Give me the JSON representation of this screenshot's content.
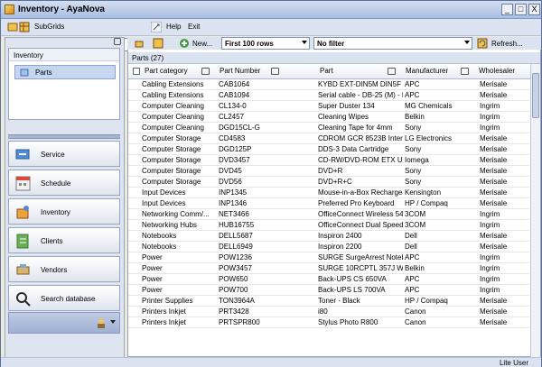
{
  "window": {
    "title": "Inventory - AyaNova",
    "controls": [
      "_",
      "□",
      "X"
    ]
  },
  "top_toolbar": {
    "subgrids_label": "SubGrids",
    "search_value": "",
    "help_label": "Help",
    "exit_label": "Exit"
  },
  "left_panel": {
    "header": "Inventory",
    "selected_item": "Parts",
    "nav_buttons": [
      {
        "label": "Service",
        "icon": "service-icon"
      },
      {
        "label": "Schedule",
        "icon": "schedule-icon"
      },
      {
        "label": "Inventory",
        "icon": "inventory-icon"
      },
      {
        "label": "Clients",
        "icon": "clients-icon"
      },
      {
        "label": "Vendors",
        "icon": "vendors-icon"
      },
      {
        "label": "Search database",
        "icon": "search-database-icon"
      }
    ]
  },
  "grid_toolbar": {
    "new_label": "New...",
    "rows_value": "First 100 rows",
    "filter_value": "No filter",
    "refresh_label": "Refresh..."
  },
  "grid": {
    "title": "Parts (27)",
    "columns": [
      "Part category",
      "Part Number",
      "Part",
      "Manufacturer",
      "Wholesaler"
    ],
    "rows": [
      [
        "Cabling Extensions",
        "CAB1064",
        "KYBD EXT-DIN5M DIN5F 6FT",
        "APC",
        "Merisale"
      ],
      [
        "Cabling Extensions",
        "CAB1094",
        "Serial cable - DB-25 (M) - DB-...",
        "APC",
        "Merisale"
      ],
      [
        "Computer Cleaning",
        "CL134-0",
        "Super Duster 134",
        "MG Chemicals",
        "Ingrim"
      ],
      [
        "Computer Cleaning",
        "CL2457",
        "Cleaning Wipes",
        "Belkin",
        "Ingrim"
      ],
      [
        "Computer Cleaning",
        "DGD15CL-G",
        "Cleaning Tape for 4mm",
        "Sony",
        "Ingrim"
      ],
      [
        "Computer Storage",
        "CD4583",
        "CDROM GCR 8523B Internal",
        "LG Electronics",
        "Merisale"
      ],
      [
        "Computer Storage",
        "DGD125P",
        "DDS-3 Data Cartridge",
        "Sony",
        "Merisale"
      ],
      [
        "Computer Storage",
        "DVD3457",
        "CD-RW/DVD-ROM ETX USB",
        "Iomega",
        "Merisale"
      ],
      [
        "Computer Storage",
        "DVD45",
        "DVD+R",
        "Sony",
        "Merisale"
      ],
      [
        "Computer Storage",
        "DVD56",
        "DVD+R+C",
        "Sony",
        "Merisale"
      ],
      [
        "Input Devices",
        "INP1345",
        "Mouse-in-a-Box Rechargeabl...",
        "Kensington",
        "Merisale"
      ],
      [
        "Input Devices",
        "INP1346",
        "Preferred Pro Keyboard",
        "HP / Compaq",
        "Merisale"
      ],
      [
        "Networking Comm/...",
        "NET3466",
        "OfficeConnect Wireless 54Mb...",
        "3COM",
        "Ingrim"
      ],
      [
        "Networking Hubs",
        "HUB16755",
        "OfficeConnect Dual Speed Hu...",
        "3COM",
        "Ingrim"
      ],
      [
        "Notebooks",
        "DELL5687",
        "Inspiron 2400",
        "Dell",
        "Merisale"
      ],
      [
        "Notebooks",
        "DELL6949",
        "Inspiron 2200",
        "Dell",
        "Merisale"
      ],
      [
        "Power",
        "POW1236",
        "SURGE SurgeArrest Noteboo...",
        "APC",
        "Ingrim"
      ],
      [
        "Power",
        "POW3457",
        "SURGE 10RCPTL 357J WM 5...",
        "Belkin",
        "Ingrim"
      ],
      [
        "Power",
        "POW650",
        "Back-UPS CS 650VA",
        "APC",
        "Ingrim"
      ],
      [
        "Power",
        "POW700",
        "Back-UPS LS 700VA",
        "APC",
        "Ingrim"
      ],
      [
        "Printer Supplies",
        "TON3964A",
        "Toner - Black",
        "HP / Compaq",
        "Merisale"
      ],
      [
        "Printers Inkjet",
        "PRT3428",
        "i80",
        "Canon",
        "Merisale"
      ],
      [
        "Printers Inkjet",
        "PRTSPR800",
        "Stylus Photo R800",
        "Canon",
        "Merisale"
      ]
    ]
  },
  "status": {
    "user": "Lite User"
  }
}
